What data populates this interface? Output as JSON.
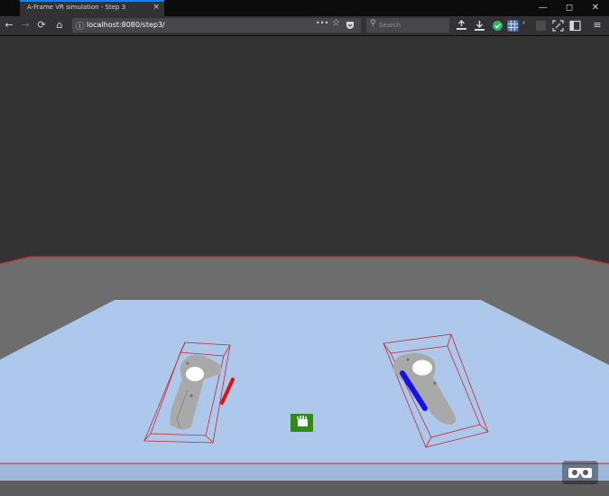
{
  "browser": {
    "tab_title": "A-Frame VR simulation - Step 3",
    "tab_close": "×",
    "url": "localhost:8080/step3/",
    "search_placeholder": "Search",
    "window_controls": {
      "minimize": "—",
      "maximize": "◻",
      "close": "✕"
    },
    "nav": {
      "back": "←",
      "forward": "→",
      "reload": "⟳",
      "home": "⌂",
      "menu": "≡",
      "more": "•••"
    }
  },
  "scene": {
    "sky_color": "#333333",
    "floor_color": "#aec8eb",
    "wall_color": "#6d6d6d",
    "boundary_color": "#c0282f",
    "left_ray_color": "#e01010",
    "right_ray_color": "#1410e6",
    "marker_color": "#2e8b18",
    "controller_color": "#a9a9a9",
    "vr_button_icon": "vr-goggles-icon"
  }
}
